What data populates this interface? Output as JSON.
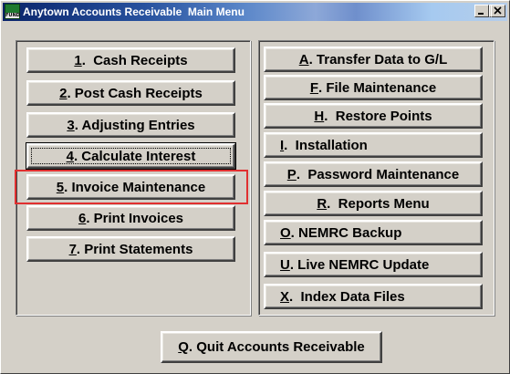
{
  "window": {
    "title": "Anytown Accounts Receivable  Main Menu",
    "icon_label": "FUND",
    "controls": [
      "minimize-icon",
      "maximize-icon",
      "close-icon"
    ]
  },
  "left_menu": [
    {
      "key": "1",
      "rest": ".  Cash Receipts"
    },
    {
      "key": "2",
      "rest": ". Post Cash Receipts"
    },
    {
      "key": "3",
      "rest": ". Adjusting Entries"
    },
    {
      "key": "4",
      "rest": ". Calculate Interest"
    },
    {
      "key": "5",
      "rest": ". Invoice Maintenance"
    },
    {
      "key": "6",
      "rest": ". Print Invoices"
    },
    {
      "key": "7",
      "rest": ". Print Statements"
    }
  ],
  "right_menu": [
    {
      "key": "A",
      "rest": ". Transfer Data to G/L"
    },
    {
      "key": "F",
      "rest": ". File Maintenance"
    },
    {
      "key": "H",
      "rest": ".  Restore Points"
    },
    {
      "key": "I",
      "rest": ".  Installation"
    },
    {
      "key": "P",
      "rest": ".  Password Maintenance"
    },
    {
      "key": "R",
      "rest": ".  Reports Menu"
    },
    {
      "key": "O",
      "rest": ". NEMRC Backup"
    },
    {
      "key": "U",
      "rest": ". Live NEMRC Update"
    },
    {
      "key": "X",
      "rest": ".  Index Data Files"
    }
  ],
  "quit_button": {
    "key": "Q",
    "rest": ". Quit Accounts Receivable"
  },
  "highlight_color": "#e03030"
}
